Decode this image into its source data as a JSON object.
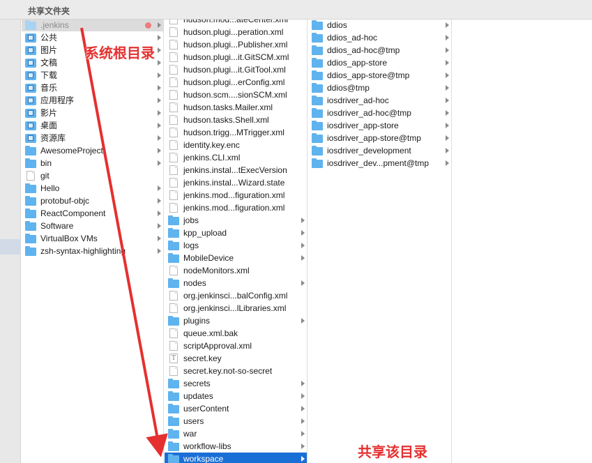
{
  "header": {
    "title": "共享文件夹"
  },
  "column1": [
    {
      "label": ".jenkins",
      "icon": "folder-pale",
      "chevron": true,
      "state": "selected-gray",
      "tag": "red"
    },
    {
      "label": "公共",
      "icon": "system-folder",
      "chevron": true
    },
    {
      "label": "图片",
      "icon": "system-folder",
      "chevron": true
    },
    {
      "label": "文稿",
      "icon": "system-folder",
      "chevron": true
    },
    {
      "label": "下载",
      "icon": "system-folder",
      "chevron": true
    },
    {
      "label": "音乐",
      "icon": "system-folder",
      "chevron": true
    },
    {
      "label": "应用程序",
      "icon": "system-folder",
      "chevron": true
    },
    {
      "label": "影片",
      "icon": "system-folder",
      "chevron": true
    },
    {
      "label": "桌面",
      "icon": "system-folder",
      "chevron": true
    },
    {
      "label": "资源库",
      "icon": "system-folder",
      "chevron": true
    },
    {
      "label": "AwesomeProject",
      "icon": "folder",
      "chevron": true
    },
    {
      "label": "bin",
      "icon": "folder",
      "chevron": true
    },
    {
      "label": "git",
      "icon": "document",
      "chevron": false
    },
    {
      "label": "Hello",
      "icon": "folder",
      "chevron": true
    },
    {
      "label": "protobuf-objc",
      "icon": "folder",
      "chevron": true
    },
    {
      "label": "ReactComponent",
      "icon": "folder",
      "chevron": true
    },
    {
      "label": "Software",
      "icon": "folder",
      "chevron": true
    },
    {
      "label": "VirtualBox VMs",
      "icon": "folder",
      "chevron": true
    },
    {
      "label": "zsh-syntax-highlighting",
      "icon": "folder",
      "chevron": true
    }
  ],
  "column2": [
    {
      "label": "hudson.mod...ateCenter.xml",
      "icon": "document",
      "chevron": false
    },
    {
      "label": "hudson.plugi...peration.xml",
      "icon": "document",
      "chevron": false
    },
    {
      "label": "hudson.plugi...Publisher.xml",
      "icon": "document",
      "chevron": false
    },
    {
      "label": "hudson.plugi...it.GitSCM.xml",
      "icon": "document",
      "chevron": false
    },
    {
      "label": "hudson.plugi...it.GitTool.xml",
      "icon": "document",
      "chevron": false
    },
    {
      "label": "hudson.plugi...erConfig.xml",
      "icon": "document",
      "chevron": false
    },
    {
      "label": "hudson.scm....sionSCM.xml",
      "icon": "document",
      "chevron": false
    },
    {
      "label": "hudson.tasks.Mailer.xml",
      "icon": "document",
      "chevron": false
    },
    {
      "label": "hudson.tasks.Shell.xml",
      "icon": "document",
      "chevron": false
    },
    {
      "label": "hudson.trigg...MTrigger.xml",
      "icon": "document",
      "chevron": false
    },
    {
      "label": "identity.key.enc",
      "icon": "document",
      "chevron": false
    },
    {
      "label": "jenkins.CLI.xml",
      "icon": "document",
      "chevron": false
    },
    {
      "label": "jenkins.instal...tExecVersion",
      "icon": "document",
      "chevron": false
    },
    {
      "label": "jenkins.instal...Wizard.state",
      "icon": "document",
      "chevron": false
    },
    {
      "label": "jenkins.mod...figuration.xml",
      "icon": "document",
      "chevron": false
    },
    {
      "label": "jenkins.mod...figuration.xml",
      "icon": "document",
      "chevron": false
    },
    {
      "label": "jobs",
      "icon": "folder",
      "chevron": true
    },
    {
      "label": "kpp_upload",
      "icon": "folder",
      "chevron": true
    },
    {
      "label": "logs",
      "icon": "folder",
      "chevron": true
    },
    {
      "label": "MobileDevice",
      "icon": "folder",
      "chevron": true
    },
    {
      "label": "nodeMonitors.xml",
      "icon": "document",
      "chevron": false
    },
    {
      "label": "nodes",
      "icon": "folder",
      "chevron": true
    },
    {
      "label": "org.jenkinsci...balConfig.xml",
      "icon": "document",
      "chevron": false
    },
    {
      "label": "org.jenkinsci...lLibraries.xml",
      "icon": "document",
      "chevron": false
    },
    {
      "label": "plugins",
      "icon": "folder",
      "chevron": true
    },
    {
      "label": "queue.xml.bak",
      "icon": "document",
      "chevron": false
    },
    {
      "label": "scriptApproval.xml",
      "icon": "document",
      "chevron": false
    },
    {
      "label": "secret.key",
      "icon": "text-document",
      "chevron": false
    },
    {
      "label": "secret.key.not-so-secret",
      "icon": "document",
      "chevron": false
    },
    {
      "label": "secrets",
      "icon": "folder",
      "chevron": true
    },
    {
      "label": "updates",
      "icon": "folder",
      "chevron": true
    },
    {
      "label": "userContent",
      "icon": "folder",
      "chevron": true
    },
    {
      "label": "users",
      "icon": "folder",
      "chevron": true
    },
    {
      "label": "war",
      "icon": "folder",
      "chevron": true
    },
    {
      "label": "workflow-libs",
      "icon": "folder",
      "chevron": true
    },
    {
      "label": "workspace",
      "icon": "folder",
      "chevron": true,
      "state": "selected-blue"
    }
  ],
  "column3": [
    {
      "label": "ddios",
      "icon": "folder",
      "chevron": true
    },
    {
      "label": "ddios_ad-hoc",
      "icon": "folder",
      "chevron": true
    },
    {
      "label": "ddios_ad-hoc@tmp",
      "icon": "folder",
      "chevron": true
    },
    {
      "label": "ddios_app-store",
      "icon": "folder",
      "chevron": true
    },
    {
      "label": "ddios_app-store@tmp",
      "icon": "folder",
      "chevron": true
    },
    {
      "label": "ddios@tmp",
      "icon": "folder",
      "chevron": true
    },
    {
      "label": "iosdriver_ad-hoc",
      "icon": "folder",
      "chevron": true
    },
    {
      "label": "iosdriver_ad-hoc@tmp",
      "icon": "folder",
      "chevron": true
    },
    {
      "label": "iosdriver_app-store",
      "icon": "folder",
      "chevron": true
    },
    {
      "label": "iosdriver_app-store@tmp",
      "icon": "folder",
      "chevron": true
    },
    {
      "label": "iosdriver_development",
      "icon": "folder",
      "chevron": true
    },
    {
      "label": "iosdriver_dev...pment@tmp",
      "icon": "folder",
      "chevron": true
    }
  ],
  "annotations": {
    "root_label": "系统根目录",
    "share_label": "共享该目录",
    "color": "#e53030"
  },
  "colors": {
    "selection_blue": "#1a6fd6",
    "selection_gray": "#dcdcdc",
    "folder": "#5fb3ee",
    "tag_red": "#f07b7b"
  }
}
